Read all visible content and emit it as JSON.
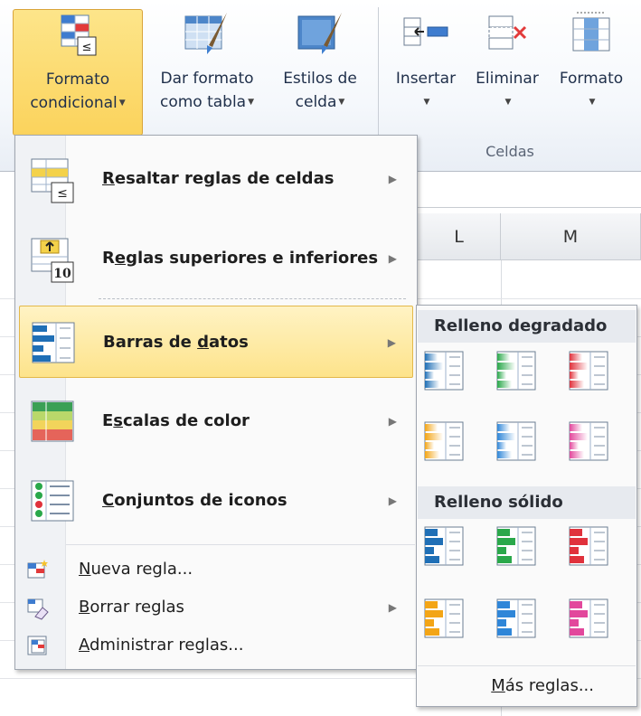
{
  "ribbon": {
    "formato_condicional": {
      "line1": "Formato",
      "line2": "condicional"
    },
    "dar_formato": {
      "line1": "Dar formato",
      "line2": "como tabla"
    },
    "estilos_celda": {
      "line1": "Estilos de",
      "line2": "celda"
    },
    "insertar": "Insertar",
    "eliminar": "Eliminar",
    "formato": "Formato",
    "group_celdas": "Celdas"
  },
  "sheet": {
    "columns": [
      "L",
      "M"
    ]
  },
  "menu": {
    "items": [
      {
        "label_pre": "",
        "label_u": "R",
        "label_post": "esaltar reglas de celdas",
        "icon": "highlight-rules-icon"
      },
      {
        "label_pre": "R",
        "label_u": "e",
        "label_post": "glas superiores e inferiores",
        "icon": "top-bottom-rules-icon"
      },
      {
        "label_pre": "Barras de ",
        "label_u": "d",
        "label_post": "atos",
        "icon": "data-bars-icon"
      },
      {
        "label_pre": "E",
        "label_u": "s",
        "label_post": "calas de color",
        "icon": "color-scales-icon"
      },
      {
        "label_pre": "",
        "label_u": "C",
        "label_post": "onjuntos de iconos",
        "icon": "icon-sets-icon"
      }
    ],
    "actions": [
      {
        "label_u": "N",
        "label_post": "ueva regla...",
        "icon": "new-rule-icon"
      },
      {
        "label_u": "B",
        "label_post": "orrar reglas",
        "icon": "clear-rules-icon"
      },
      {
        "label_u": "A",
        "label_post": "dministrar reglas...",
        "icon": "manage-rules-icon"
      }
    ]
  },
  "submenu": {
    "gradient_header": "Relleno degradado",
    "solid_header": "Relleno sólido",
    "more_u": "M",
    "more_post": "ás reglas...",
    "colors": [
      "#1f6fb6",
      "#2aa84a",
      "#e0323c",
      "#f3a516",
      "#2f86d8",
      "#e2489c"
    ]
  },
  "colors": {
    "highlight": "#fde38b",
    "ribbon_active": "#fbd35c"
  }
}
